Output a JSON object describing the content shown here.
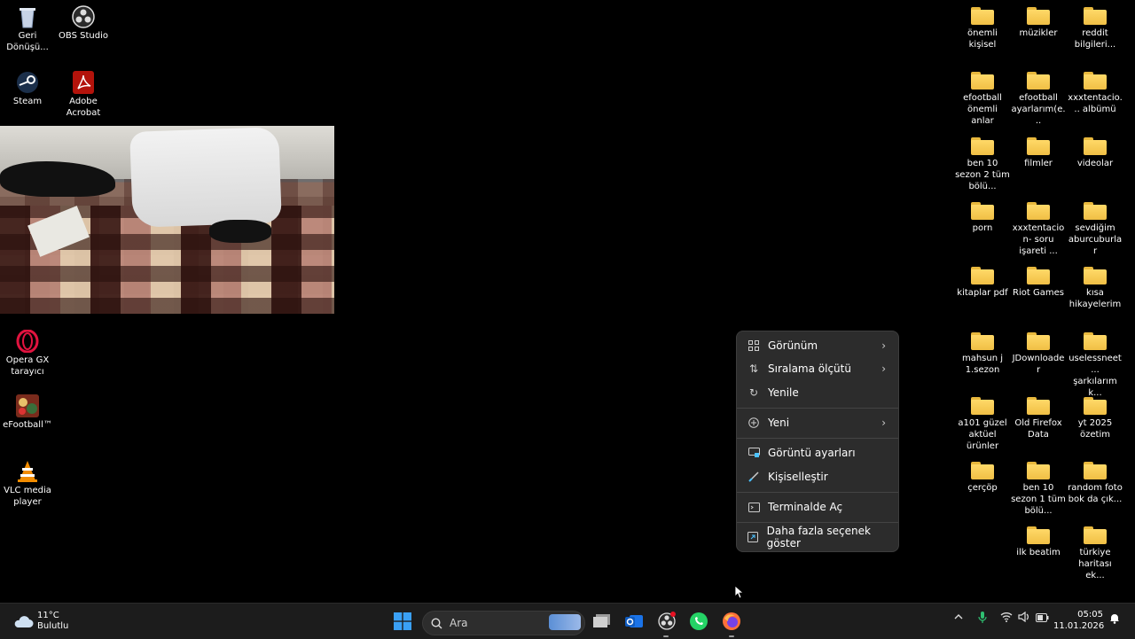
{
  "desktop": {
    "left_icons": [
      {
        "name": "Geri Dönüşü...",
        "icon": "recycle-bin-icon"
      },
      {
        "name": "OBS Studio",
        "icon": "obs-icon"
      },
      {
        "name": "Steam",
        "icon": "steam-icon"
      },
      {
        "name": "Adobe Acrobat",
        "icon": "acrobat-icon"
      },
      {
        "name": "Opera GX tarayıcı",
        "icon": "opera-gx-icon"
      },
      {
        "name": "eFootball™",
        "icon": "efootball-icon"
      },
      {
        "name": "VLC media player",
        "icon": "vlc-icon"
      }
    ],
    "folders": [
      "önemli kişisel",
      "müzikler",
      "reddit bilgileri...",
      "efootball önemli anlar",
      "efootball ayarlarım(e...",
      "xxxtentacio... albümü",
      "ben 10 sezon 2 tüm bölü...",
      "filmler",
      "videolar",
      "porn",
      "xxxtentacion- soru işareti ...",
      "sevdiğim aburcuburlar",
      "kitaplar pdf",
      "Riot Games",
      "kısa hikayelerim",
      "mahsun j 1.sezon",
      "JDownloader",
      "uselessneet... şarkılarım k...",
      "a101 güzel aktüel ürünler",
      "Old Firefox Data",
      "yt 2025 özetim",
      "çerçöp",
      "ben 10 sezon 1 tüm bölü...",
      "random foto bok da çık...",
      "ilk beatim",
      "türkiye haritası ek..."
    ]
  },
  "context_menu": {
    "items": [
      {
        "label": "Görünüm",
        "icon": "grid-icon",
        "submenu": true
      },
      {
        "label": "Sıralama ölçütü",
        "icon": "sort-icon",
        "submenu": true
      },
      {
        "label": "Yenile",
        "icon": "refresh-icon",
        "submenu": false
      },
      {
        "label": "Yeni",
        "icon": "plus-circle-icon",
        "submenu": true
      },
      {
        "label": "Görüntü ayarları",
        "icon": "display-icon",
        "submenu": false
      },
      {
        "label": "Kişiselleştir",
        "icon": "brush-icon",
        "submenu": false
      },
      {
        "label": "Terminalde Aç",
        "icon": "terminal-icon",
        "submenu": false
      },
      {
        "label": "Daha fazla seçenek göster",
        "icon": "expand-icon",
        "submenu": false
      }
    ]
  },
  "taskbar": {
    "weather": {
      "temp": "11°C",
      "condition": "Bulutlu",
      "icon": "cloud-icon"
    },
    "search_placeholder": "Ara",
    "apps": [
      "start-icon",
      "file-explorer-icon",
      "outlook-icon",
      "obs-icon",
      "whatsapp-icon",
      "firefox-icon"
    ],
    "time": "05:05",
    "date": "11.01.2026"
  },
  "colors": {
    "taskbar_bg": "#1c1c1c",
    "menu_bg": "#2c2c2c",
    "folder": "#f5c84d",
    "accent": "#4cc2ff"
  }
}
